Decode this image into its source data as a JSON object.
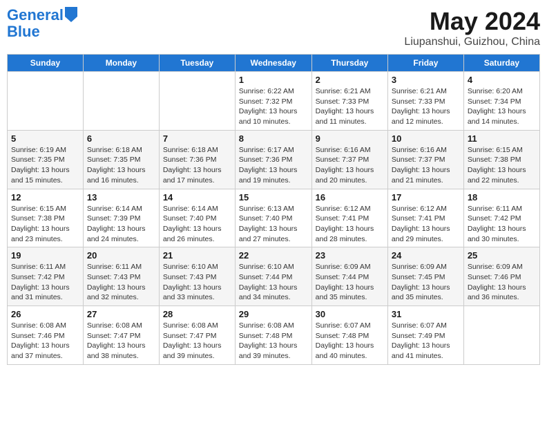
{
  "header": {
    "logo_line1": "General",
    "logo_line2": "Blue",
    "month": "May 2024",
    "location": "Liupanshui, Guizhou, China"
  },
  "weekdays": [
    "Sunday",
    "Monday",
    "Tuesday",
    "Wednesday",
    "Thursday",
    "Friday",
    "Saturday"
  ],
  "weeks": [
    [
      {
        "day": "",
        "info": ""
      },
      {
        "day": "",
        "info": ""
      },
      {
        "day": "",
        "info": ""
      },
      {
        "day": "1",
        "info": "Sunrise: 6:22 AM\nSunset: 7:32 PM\nDaylight: 13 hours and 10 minutes."
      },
      {
        "day": "2",
        "info": "Sunrise: 6:21 AM\nSunset: 7:33 PM\nDaylight: 13 hours and 11 minutes."
      },
      {
        "day": "3",
        "info": "Sunrise: 6:21 AM\nSunset: 7:33 PM\nDaylight: 13 hours and 12 minutes."
      },
      {
        "day": "4",
        "info": "Sunrise: 6:20 AM\nSunset: 7:34 PM\nDaylight: 13 hours and 14 minutes."
      }
    ],
    [
      {
        "day": "5",
        "info": "Sunrise: 6:19 AM\nSunset: 7:35 PM\nDaylight: 13 hours and 15 minutes."
      },
      {
        "day": "6",
        "info": "Sunrise: 6:18 AM\nSunset: 7:35 PM\nDaylight: 13 hours and 16 minutes."
      },
      {
        "day": "7",
        "info": "Sunrise: 6:18 AM\nSunset: 7:36 PM\nDaylight: 13 hours and 17 minutes."
      },
      {
        "day": "8",
        "info": "Sunrise: 6:17 AM\nSunset: 7:36 PM\nDaylight: 13 hours and 19 minutes."
      },
      {
        "day": "9",
        "info": "Sunrise: 6:16 AM\nSunset: 7:37 PM\nDaylight: 13 hours and 20 minutes."
      },
      {
        "day": "10",
        "info": "Sunrise: 6:16 AM\nSunset: 7:37 PM\nDaylight: 13 hours and 21 minutes."
      },
      {
        "day": "11",
        "info": "Sunrise: 6:15 AM\nSunset: 7:38 PM\nDaylight: 13 hours and 22 minutes."
      }
    ],
    [
      {
        "day": "12",
        "info": "Sunrise: 6:15 AM\nSunset: 7:38 PM\nDaylight: 13 hours and 23 minutes."
      },
      {
        "day": "13",
        "info": "Sunrise: 6:14 AM\nSunset: 7:39 PM\nDaylight: 13 hours and 24 minutes."
      },
      {
        "day": "14",
        "info": "Sunrise: 6:14 AM\nSunset: 7:40 PM\nDaylight: 13 hours and 26 minutes."
      },
      {
        "day": "15",
        "info": "Sunrise: 6:13 AM\nSunset: 7:40 PM\nDaylight: 13 hours and 27 minutes."
      },
      {
        "day": "16",
        "info": "Sunrise: 6:12 AM\nSunset: 7:41 PM\nDaylight: 13 hours and 28 minutes."
      },
      {
        "day": "17",
        "info": "Sunrise: 6:12 AM\nSunset: 7:41 PM\nDaylight: 13 hours and 29 minutes."
      },
      {
        "day": "18",
        "info": "Sunrise: 6:11 AM\nSunset: 7:42 PM\nDaylight: 13 hours and 30 minutes."
      }
    ],
    [
      {
        "day": "19",
        "info": "Sunrise: 6:11 AM\nSunset: 7:42 PM\nDaylight: 13 hours and 31 minutes."
      },
      {
        "day": "20",
        "info": "Sunrise: 6:11 AM\nSunset: 7:43 PM\nDaylight: 13 hours and 32 minutes."
      },
      {
        "day": "21",
        "info": "Sunrise: 6:10 AM\nSunset: 7:43 PM\nDaylight: 13 hours and 33 minutes."
      },
      {
        "day": "22",
        "info": "Sunrise: 6:10 AM\nSunset: 7:44 PM\nDaylight: 13 hours and 34 minutes."
      },
      {
        "day": "23",
        "info": "Sunrise: 6:09 AM\nSunset: 7:44 PM\nDaylight: 13 hours and 35 minutes."
      },
      {
        "day": "24",
        "info": "Sunrise: 6:09 AM\nSunset: 7:45 PM\nDaylight: 13 hours and 35 minutes."
      },
      {
        "day": "25",
        "info": "Sunrise: 6:09 AM\nSunset: 7:46 PM\nDaylight: 13 hours and 36 minutes."
      }
    ],
    [
      {
        "day": "26",
        "info": "Sunrise: 6:08 AM\nSunset: 7:46 PM\nDaylight: 13 hours and 37 minutes."
      },
      {
        "day": "27",
        "info": "Sunrise: 6:08 AM\nSunset: 7:47 PM\nDaylight: 13 hours and 38 minutes."
      },
      {
        "day": "28",
        "info": "Sunrise: 6:08 AM\nSunset: 7:47 PM\nDaylight: 13 hours and 39 minutes."
      },
      {
        "day": "29",
        "info": "Sunrise: 6:08 AM\nSunset: 7:48 PM\nDaylight: 13 hours and 39 minutes."
      },
      {
        "day": "30",
        "info": "Sunrise: 6:07 AM\nSunset: 7:48 PM\nDaylight: 13 hours and 40 minutes."
      },
      {
        "day": "31",
        "info": "Sunrise: 6:07 AM\nSunset: 7:49 PM\nDaylight: 13 hours and 41 minutes."
      },
      {
        "day": "",
        "info": ""
      }
    ]
  ]
}
